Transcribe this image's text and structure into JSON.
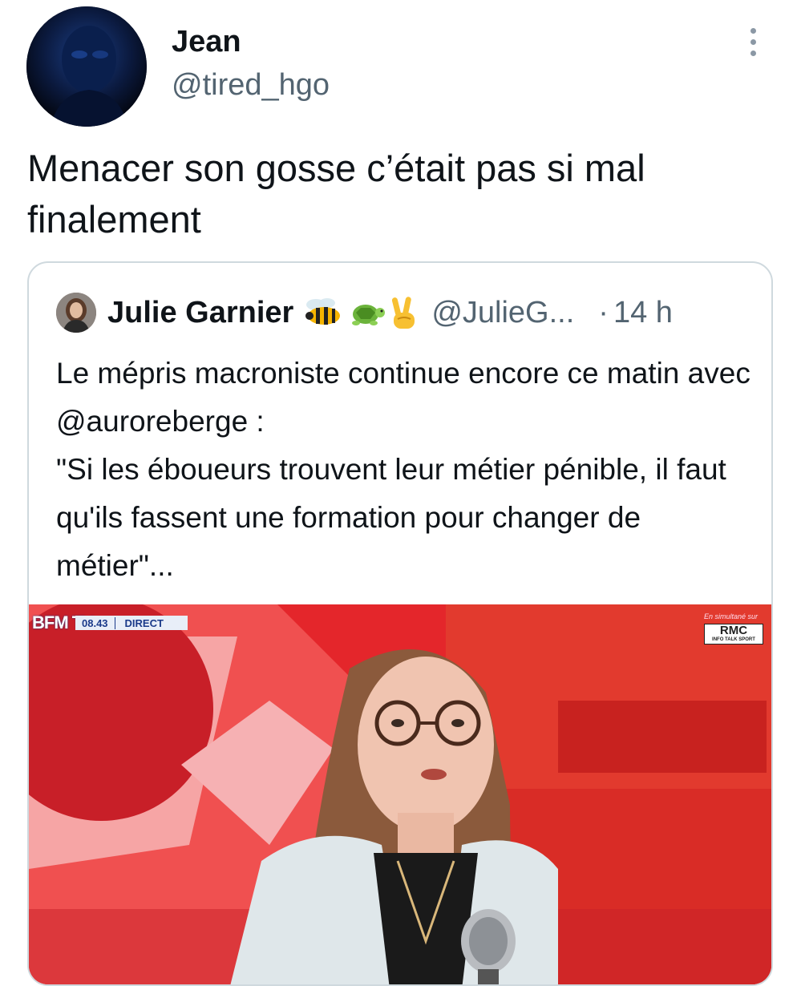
{
  "tweet": {
    "author_name": "Jean",
    "author_handle": "@tired_hgo",
    "text": "Menacer son gosse c’était pas si mal finalement",
    "more_icon": "more-vertical-icon"
  },
  "quote": {
    "author_name": "Julie Garnier",
    "author_emojis": [
      "bee-emoji",
      "turtle-emoji",
      "victory-hand-emoji"
    ],
    "author_handle": "@JulieG...",
    "separator": "·",
    "time": "14 h",
    "text": "Le mépris macroniste continue encore ce matin avec @auroreberge :\n\"Si les éboueurs trouvent leur métier pénible, il faut qu'ils fassent une formation pour changer de métier\"...",
    "media": {
      "channel_logo": "BFM TV.",
      "clock": "08.43",
      "live_label": "DIRECT",
      "simulcast_label": "En simultané sur",
      "radio_logo": "RMC",
      "radio_tagline": "INFO TALK SPORT"
    }
  },
  "colors": {
    "text_primary": "#0f1419",
    "text_secondary": "#536471",
    "border": "#cfd9de",
    "media_red": "#e4262b"
  }
}
